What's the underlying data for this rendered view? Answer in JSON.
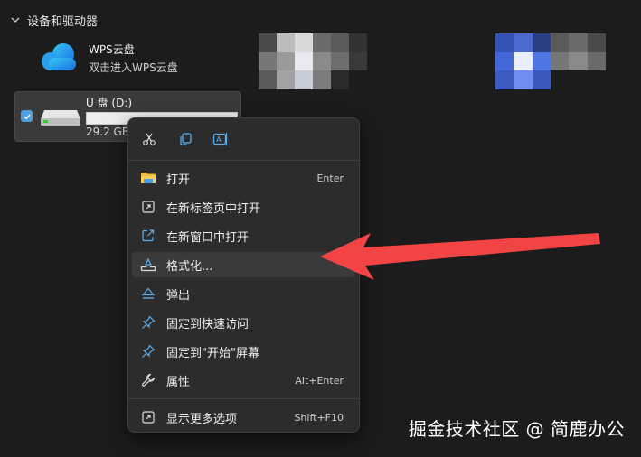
{
  "section": {
    "title": "设备和驱动器",
    "chevron_icon": "chevron-down-icon"
  },
  "wps": {
    "name": "WPS云盘",
    "subtitle": "双击进入WPS云盘",
    "icon": "cloud-icon"
  },
  "usb": {
    "name": "U 盘 (D:)",
    "size": "29.2 GB",
    "selected": true,
    "icon": "drive-icon"
  },
  "context_menu": {
    "quick_actions": [
      {
        "name": "cut",
        "icon": "scissors-icon"
      },
      {
        "name": "copy",
        "icon": "copy-icon"
      },
      {
        "name": "rename",
        "icon": "rename-icon"
      }
    ],
    "items": [
      {
        "label": "打开",
        "shortcut": "Enter",
        "icon": "folder-icon"
      },
      {
        "label": "在新标签页中打开",
        "shortcut": "",
        "icon": "new-tab-icon"
      },
      {
        "label": "在新窗口中打开",
        "shortcut": "",
        "icon": "open-external-icon"
      },
      {
        "label": "格式化...",
        "shortcut": "",
        "icon": "format-icon",
        "highlighted": true
      },
      {
        "label": "弹出",
        "shortcut": "",
        "icon": "eject-icon"
      },
      {
        "label": "固定到快速访问",
        "shortcut": "",
        "icon": "pin-icon"
      },
      {
        "label": "固定到\"开始\"屏幕",
        "shortcut": "",
        "icon": "pin-icon"
      },
      {
        "label": "属性",
        "shortcut": "Alt+Enter",
        "icon": "wrench-icon"
      },
      {
        "label": "显示更多选项",
        "shortcut": "Shift+F10",
        "icon": "more-options-icon"
      }
    ]
  },
  "watermark": {
    "text": "掘金技术社区 @ 简鹿办公"
  },
  "colors": {
    "background": "#1c1c1c",
    "menu_bg": "#2c2c2c",
    "accent_blue": "#4ca0e0",
    "arrow_red": "#f24444"
  }
}
